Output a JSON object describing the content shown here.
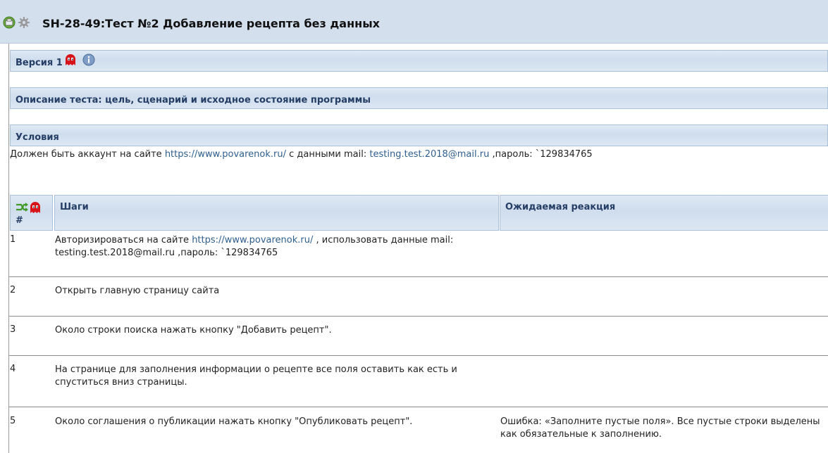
{
  "title_bar": {
    "title": "SH-28-49:Тест №2 Добавление рецепта без данных",
    "icons": [
      "export-icon",
      "settings-gear-icon"
    ]
  },
  "version": {
    "label": "Версия 1",
    "icons": [
      "ghost-icon",
      "info-icon"
    ]
  },
  "description": {
    "label": "Описание теста: цель, сценарий и исходное состояние программы"
  },
  "conditions": {
    "label": "Условия",
    "text_prefix": "Должен быть аккаунт на сайте ",
    "site_link": "https://www.povarenok.ru/",
    "text_middle": " с данными mail: ",
    "email_link": "testing.test.2018@mail.ru",
    "text_suffix": " ,пароль: `129834765"
  },
  "steps_table": {
    "columns": {
      "number": "#",
      "steps": "Шаги",
      "expected": "Ожидаемая реакция"
    },
    "header_icons": [
      "shuffle-icon",
      "ghost-icon"
    ],
    "rows": [
      {
        "num": "1",
        "step_prefix": "Авторизироваться на сайте ",
        "step_link": "https://www.povarenok.ru/",
        "step_suffix": " , использовать данные mail: testing.test.2018@mail.ru  ,пароль: `129834765",
        "expected": ""
      },
      {
        "num": "2",
        "step": "Открыть главную страницу сайта",
        "expected": ""
      },
      {
        "num": "3",
        "step": "Около строки поиска нажать кнопку \"Добавить рецепт\".",
        "expected": ""
      },
      {
        "num": "4",
        "step": "На странице для заполнения информации о рецепте все поля оставить как есть и спуститься вниз страницы.",
        "expected": ""
      },
      {
        "num": "5",
        "step": "Около соглашения о публикации нажать кнопку \"Опубликовать рецепт\".",
        "expected": "Ошибка: «Заполните пустые поля». Все пустые строки выделены как обязательные к заполнению."
      }
    ]
  }
}
